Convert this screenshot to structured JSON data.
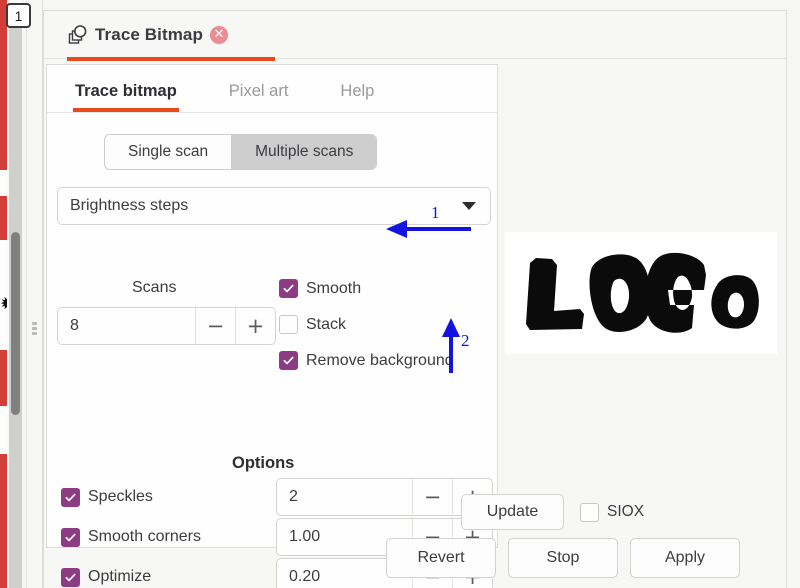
{
  "window": {
    "title": "Trace Bitmap",
    "title_icon": "trace-bitmap-icon",
    "close_icon": "close-icon",
    "accent_color": "#e8491d",
    "checkbox_on_color": "#8d3b82",
    "annotation_color": "#1414e0"
  },
  "overlay": {
    "step_badge": "1"
  },
  "tabs": [
    {
      "label": "Trace bitmap",
      "active": true
    },
    {
      "label": "Pixel art",
      "active": false
    },
    {
      "label": "Help",
      "active": false
    }
  ],
  "scan_mode": {
    "options": [
      "Single scan",
      "Multiple scans"
    ],
    "selected": "Multiple scans"
  },
  "detection_mode": {
    "label": "Brightness steps",
    "caret_icon": "chevron-down-icon"
  },
  "scans": {
    "label": "Scans",
    "value": "8",
    "minus_label": "−",
    "plus_label": "+"
  },
  "toggles": [
    {
      "name": "smooth",
      "label": "Smooth",
      "checked": true
    },
    {
      "name": "stack",
      "label": "Stack",
      "checked": false
    },
    {
      "name": "remove-background",
      "label": "Remove background",
      "checked": true
    }
  ],
  "options": {
    "title": "Options",
    "rows": [
      {
        "name": "speckles",
        "label": "Speckles",
        "checked": true,
        "value": "2"
      },
      {
        "name": "smooth-corners",
        "label": "Smooth corners",
        "checked": true,
        "value": "1.00"
      },
      {
        "name": "optimize",
        "label": "Optimize",
        "checked": true,
        "value": "0.20"
      }
    ],
    "minus_label": "−",
    "plus_label": "+"
  },
  "preview": {
    "image_alt": "LOGO",
    "logo_text": "LOGO"
  },
  "update": {
    "button_label": "Update",
    "siox_label": "SIOX",
    "siox_checked": false
  },
  "actions": [
    {
      "name": "revert",
      "label": "Revert"
    },
    {
      "name": "stop",
      "label": "Stop"
    },
    {
      "name": "apply",
      "label": "Apply"
    }
  ],
  "annotations": [
    {
      "id": "1",
      "label": "1",
      "points_to": "Smooth",
      "direction": "left"
    },
    {
      "id": "2",
      "label": "2",
      "points_to": "Remove background",
      "direction": "up"
    }
  ]
}
